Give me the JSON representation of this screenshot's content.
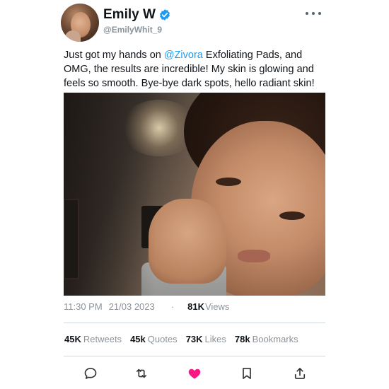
{
  "author": {
    "display_name": "Emily W",
    "handle": "@EmilyWhit_9",
    "verified": true,
    "avatar": "profile-photo"
  },
  "more_icon": "more-horizontal-icon",
  "tweet": {
    "text_before": "Just got my hands on ",
    "mention": "@Zivora",
    "text_after": " Exfoliating Pads, and OMG, the results are incredible! My skin is glowing and feels so smooth. Bye-bye dark spots, hello radiant skin!",
    "media": "selfie-photo"
  },
  "meta": {
    "time": "11:30 PM",
    "date": "21/03 2023",
    "separator": "·",
    "views_count": "81K",
    "views_label": "Views"
  },
  "stats": [
    {
      "count": "45K",
      "label": "Retweets"
    },
    {
      "count": "45k",
      "label": "Quotes"
    },
    {
      "count": "73K",
      "label": "Likes"
    },
    {
      "count": "78k",
      "label": "Bookmarks"
    }
  ],
  "actions": [
    {
      "name": "reply",
      "icon": "comment-icon"
    },
    {
      "name": "retweet",
      "icon": "retweet-icon"
    },
    {
      "name": "like",
      "icon": "heart-icon",
      "active": true
    },
    {
      "name": "bookmark",
      "icon": "bookmark-icon"
    },
    {
      "name": "share",
      "icon": "share-icon"
    }
  ],
  "colors": {
    "link": "#1d9bf0",
    "verified": "#1d9bf0",
    "like_active": "#f91880",
    "muted": "#8b939b"
  }
}
